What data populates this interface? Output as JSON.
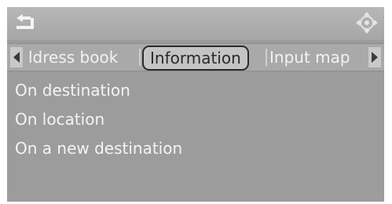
{
  "header": {
    "back_icon": "back-arrow-icon",
    "controller_icon": "controller-knob-icon"
  },
  "tabs": {
    "left_arrow_icon": "triangle-left-icon",
    "right_arrow_icon": "triangle-right-icon",
    "items": [
      {
        "label": "ldress book",
        "active": false
      },
      {
        "label": "Information",
        "active": true
      },
      {
        "label": "Input map",
        "active": false
      }
    ]
  },
  "menu": {
    "items": [
      {
        "label": "On destination"
      },
      {
        "label": "On location"
      },
      {
        "label": "On a new destination"
      }
    ]
  },
  "colors": {
    "screen_background": "#9c9c9c",
    "text": "#f4f4f4",
    "active_tab_text": "#2a2a2a"
  }
}
